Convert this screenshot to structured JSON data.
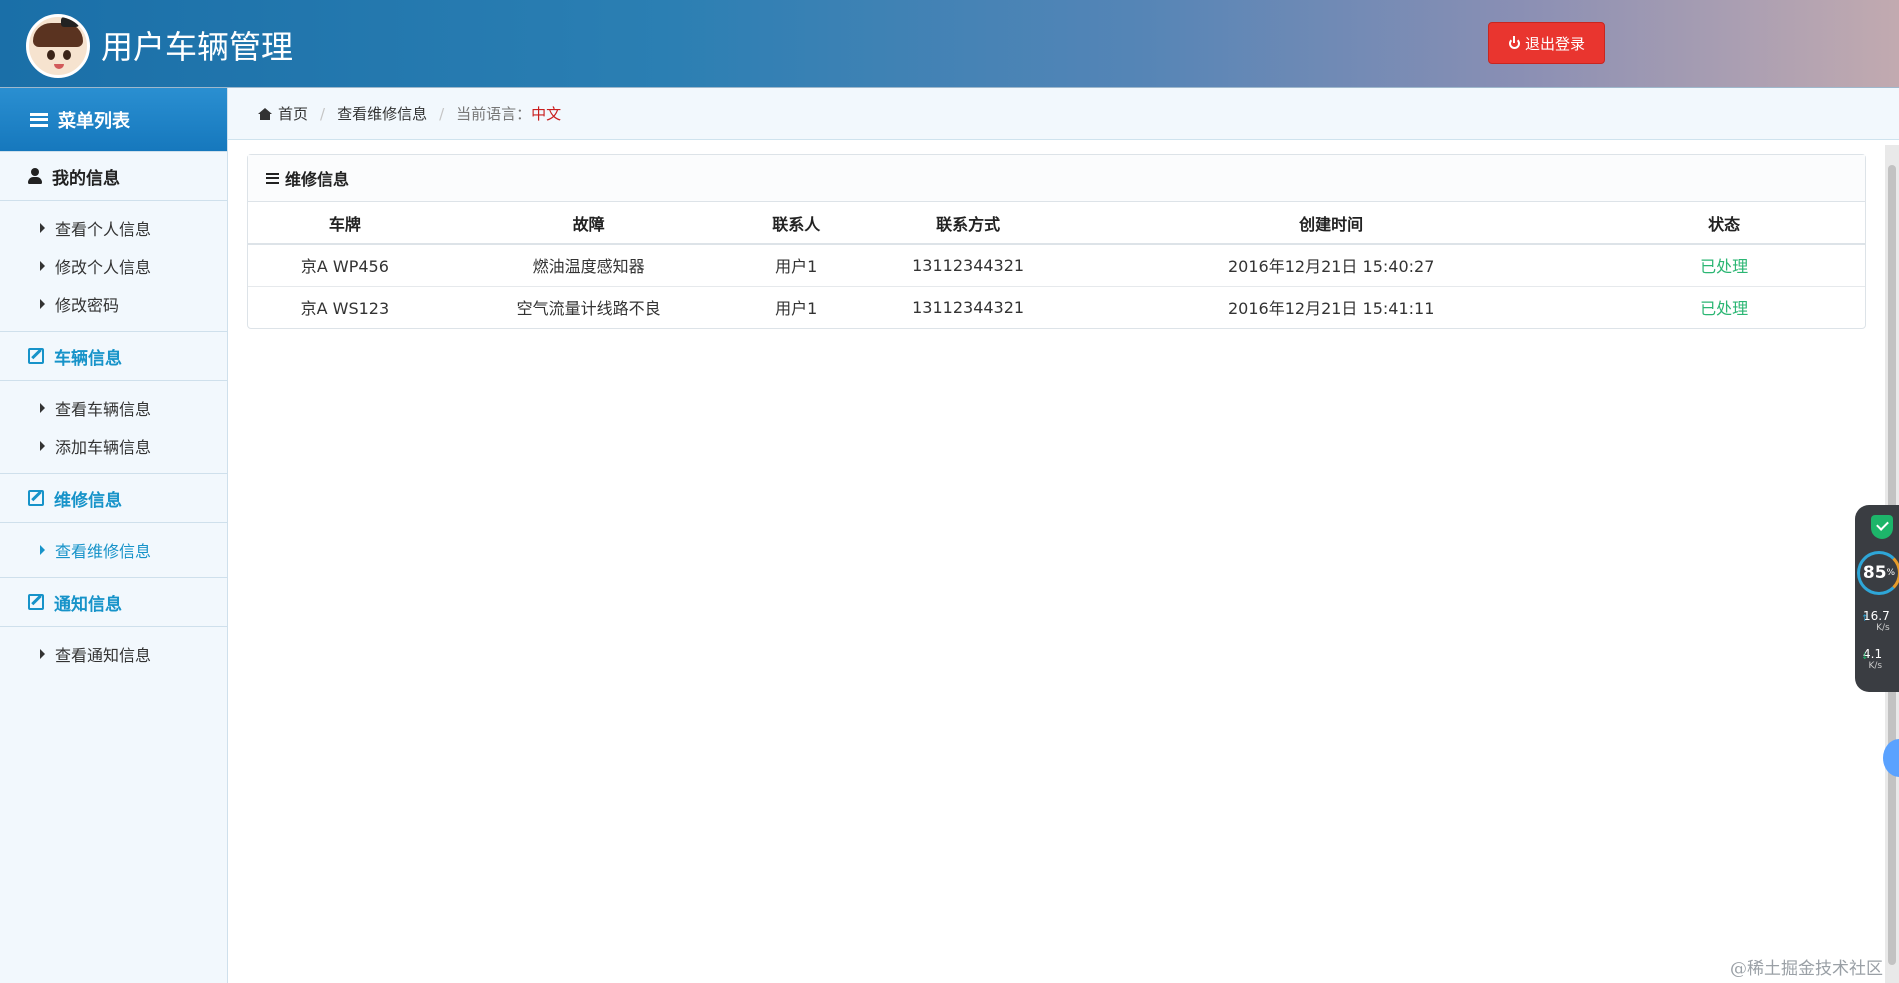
{
  "header": {
    "title": "用户车辆管理",
    "logout_label": "退出登录"
  },
  "sidebar": {
    "menu_title": "菜单列表",
    "sections": [
      {
        "label": "我的信息",
        "items": [
          "查看个人信息",
          "修改个人信息",
          "修改密码"
        ]
      },
      {
        "label": "车辆信息",
        "items": [
          "查看车辆信息",
          "添加车辆信息"
        ]
      },
      {
        "label": "维修信息",
        "items": [
          "查看维修信息"
        ],
        "active_item": "查看维修信息"
      },
      {
        "label": "通知信息",
        "items": [
          "查看通知信息"
        ]
      }
    ]
  },
  "breadcrumb": {
    "home": "首页",
    "current": "查看维修信息",
    "lang_label": "当前语言：",
    "lang_value": "中文"
  },
  "panel": {
    "title": "维修信息",
    "columns": [
      "车牌",
      "故障",
      "联系人",
      "联系方式",
      "创建时间",
      "状态"
    ],
    "rows": [
      [
        "京A WP456",
        "燃油温度感知器",
        "用户1",
        "13112344321",
        "2016年12月21日 15:40:27",
        "已处理"
      ],
      [
        "京A WS123",
        "空气流量计线路不良",
        "用户1",
        "13112344321",
        "2016年12月21日 15:41:11",
        "已处理"
      ]
    ]
  },
  "widget": {
    "percent": "85",
    "percent_unit": "%",
    "up_speed": "16.7",
    "up_unit": "K/s",
    "down_speed": "4.1",
    "down_unit": "K/s"
  },
  "watermark": "@稀土掘金技术社区",
  "colors": {
    "accent": "#1793c9",
    "logout": "#e9352f",
    "status_done": "#2bb673",
    "lang_value": "#c91e1e"
  },
  "icons": [
    "avatar",
    "power-icon",
    "list-icon",
    "person-icon",
    "edit-icon",
    "home-icon",
    "bars-icon",
    "shield-icon"
  ]
}
